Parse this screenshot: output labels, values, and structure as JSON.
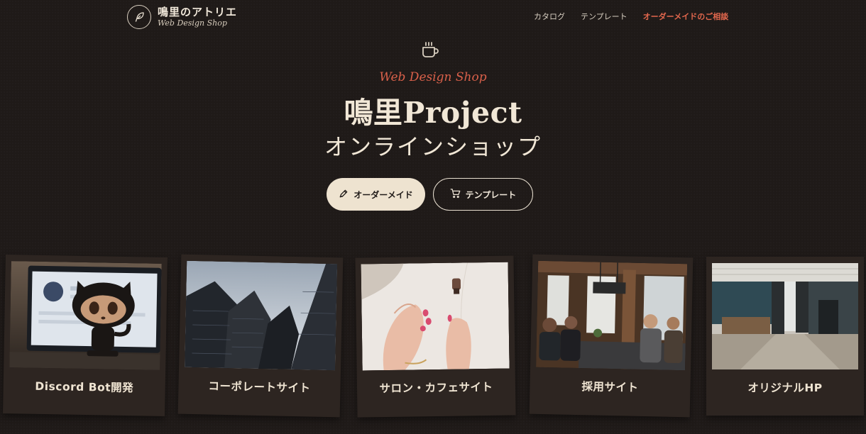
{
  "header": {
    "logo_title": "鳴里のアトリエ",
    "logo_subtitle": "Web Design Shop",
    "nav": [
      {
        "label": "カタログ"
      },
      {
        "label": "テンプレート"
      },
      {
        "label": "オーダーメイドのご相談"
      }
    ]
  },
  "hero": {
    "script": "Web Design Shop",
    "title": "鳴里Project",
    "subtitle": "オンラインショップ",
    "primary_button": "オーダーメイド",
    "secondary_button": "テンプレート"
  },
  "cards": [
    {
      "label": "Discord Bot開発"
    },
    {
      "label": "コーポレートサイト"
    },
    {
      "label": "サロン・カフェサイト"
    },
    {
      "label": "採用サイト"
    },
    {
      "label": "オリジナルHP"
    }
  ],
  "colors": {
    "background": "#1f1a18",
    "accent": "#e2674d",
    "cream": "#eee3d0",
    "card": "#2d2521"
  }
}
